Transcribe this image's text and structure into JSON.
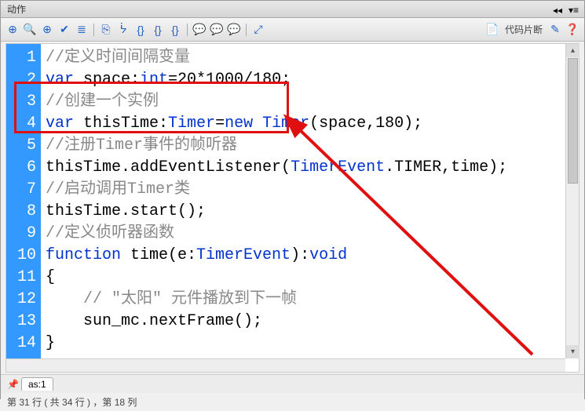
{
  "panel": {
    "title": "动作"
  },
  "toolbar_right": {
    "code_snippet": "代码片断"
  },
  "code": {
    "lines": [
      {
        "n": "1",
        "tokens": [
          {
            "t": "//定义时间间隔变量",
            "c": "comment"
          }
        ]
      },
      {
        "n": "2",
        "tokens": [
          {
            "t": "var",
            "c": "keyword"
          },
          {
            "t": " space:",
            "c": "default"
          },
          {
            "t": "int",
            "c": "type"
          },
          {
            "t": "=20*1000/180;",
            "c": "default"
          }
        ]
      },
      {
        "n": "3",
        "tokens": [
          {
            "t": "//创建一个实例",
            "c": "comment"
          }
        ]
      },
      {
        "n": "4",
        "tokens": [
          {
            "t": "var",
            "c": "keyword"
          },
          {
            "t": " thisTime:",
            "c": "default"
          },
          {
            "t": "Timer",
            "c": "type"
          },
          {
            "t": "=",
            "c": "default"
          },
          {
            "t": "new",
            "c": "keyword"
          },
          {
            "t": " ",
            "c": "default"
          },
          {
            "t": "Timer",
            "c": "type"
          },
          {
            "t": "(space,180);",
            "c": "default"
          }
        ]
      },
      {
        "n": "5",
        "tokens": [
          {
            "t": "//注册Timer事件的帧听器",
            "c": "comment"
          }
        ]
      },
      {
        "n": "6",
        "tokens": [
          {
            "t": "thisTime.addEventListener(",
            "c": "default"
          },
          {
            "t": "TimerEvent",
            "c": "type"
          },
          {
            "t": ".TIMER,time);",
            "c": "default"
          }
        ]
      },
      {
        "n": "7",
        "tokens": [
          {
            "t": "//启动调用Timer类",
            "c": "comment"
          }
        ]
      },
      {
        "n": "8",
        "tokens": [
          {
            "t": "thisTime.start();",
            "c": "default"
          }
        ]
      },
      {
        "n": "9",
        "tokens": [
          {
            "t": "//定义侦听器函数",
            "c": "comment"
          }
        ]
      },
      {
        "n": "10",
        "tokens": [
          {
            "t": "function",
            "c": "keyword"
          },
          {
            "t": " time(e:",
            "c": "default"
          },
          {
            "t": "TimerEvent",
            "c": "type"
          },
          {
            "t": "):",
            "c": "default"
          },
          {
            "t": "void",
            "c": "keyword"
          }
        ]
      },
      {
        "n": "11",
        "tokens": [
          {
            "t": "{",
            "c": "default"
          }
        ]
      },
      {
        "n": "12",
        "tokens": [
          {
            "t": "    ",
            "c": "default"
          },
          {
            "t": "// \"太阳\" 元件播放到下一帧",
            "c": "comment"
          }
        ]
      },
      {
        "n": "13",
        "tokens": [
          {
            "t": "    sun_mc.nextFrame();",
            "c": "default"
          }
        ]
      },
      {
        "n": "14",
        "tokens": [
          {
            "t": "}",
            "c": "default"
          }
        ]
      }
    ]
  },
  "tab": {
    "label": "as:1"
  },
  "status": {
    "text": "第 31 行 ( 共 34 行 ) ，第 18 列"
  }
}
